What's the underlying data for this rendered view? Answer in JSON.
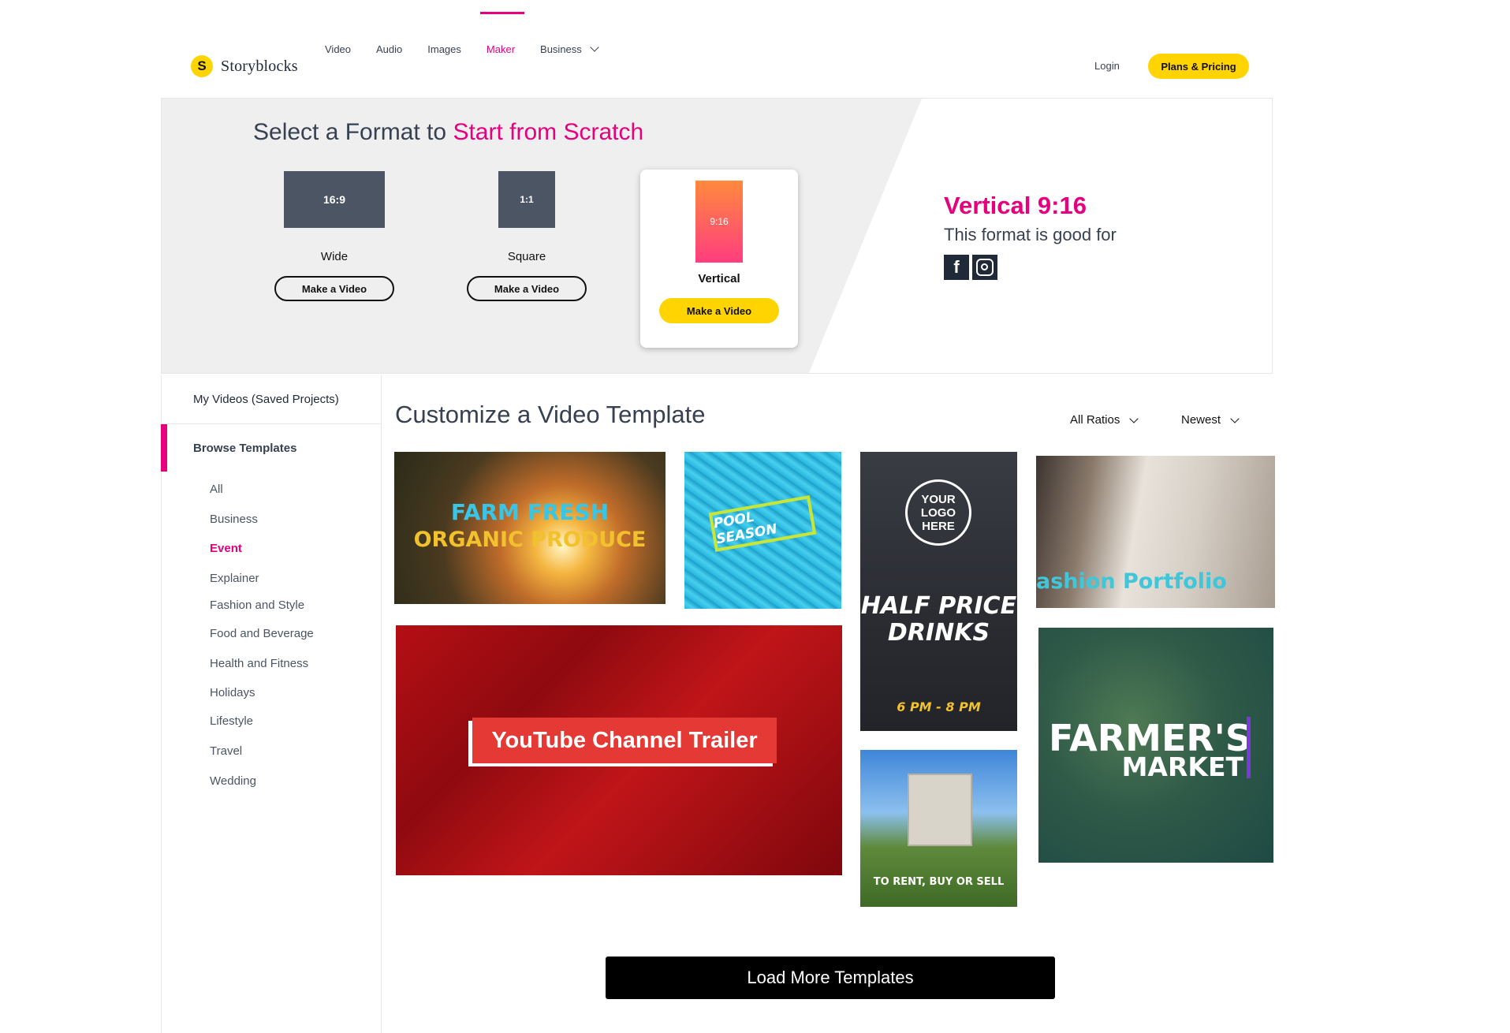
{
  "brand": {
    "logo_mark": "S",
    "name": "Storyblocks"
  },
  "nav": {
    "items": [
      "Video",
      "Audio",
      "Images",
      "Maker",
      "Business"
    ],
    "active": "Maker",
    "login": "Login",
    "pricing": "Plans & Pricing"
  },
  "hero": {
    "title_prefix": "Select a Format to",
    "title_accent": "Start from Scratch",
    "formats": [
      {
        "ratio": "16:9",
        "label": "Wide",
        "button": "Make a Video"
      },
      {
        "ratio": "1:1",
        "label": "Square",
        "button": "Make a Video"
      },
      {
        "ratio": "9:16",
        "label": "Vertical",
        "button": "Make a Video"
      }
    ],
    "selected_format": "Vertical",
    "info_title": "Vertical 9:16",
    "info_subtitle": "This format is good for",
    "social_icons": [
      "facebook-icon",
      "instagram-icon"
    ]
  },
  "sidebar": {
    "my_videos": "My Videos (Saved Projects)",
    "browse": "Browse Templates",
    "categories": [
      "All",
      "Business",
      "Event",
      "Explainer",
      "Fashion and Style",
      "Food and Beverage",
      "Health and Fitness",
      "Holidays",
      "Lifestyle",
      "Travel",
      "Wedding"
    ],
    "active_category": "Event"
  },
  "main": {
    "title": "Customize a Video Template",
    "filter_ratio": "All Ratios",
    "filter_sort": "Newest",
    "templates": {
      "farm": {
        "line1": "FARM FRESH",
        "line2": "ORGANIC PRODUCE"
      },
      "pool": {
        "text": "POOL SEASON"
      },
      "drinks": {
        "logo": "YOUR LOGO HERE",
        "line1": "HALF PRICE",
        "line2": "DRINKS",
        "time": "6 PM - 8 PM"
      },
      "fashion": {
        "text": "ashion Portfolio"
      },
      "youtube": {
        "text": "YouTube Channel Trailer"
      },
      "house": {
        "text": "TO RENT, BUY OR SELL"
      },
      "market": {
        "line1": "FARMER'S",
        "line2": "MARKET"
      }
    },
    "load_more": "Load More Templates"
  },
  "colors": {
    "accent": "#e6007e",
    "brand_yellow": "#ffd400",
    "ratio_box": "#4b5563"
  }
}
